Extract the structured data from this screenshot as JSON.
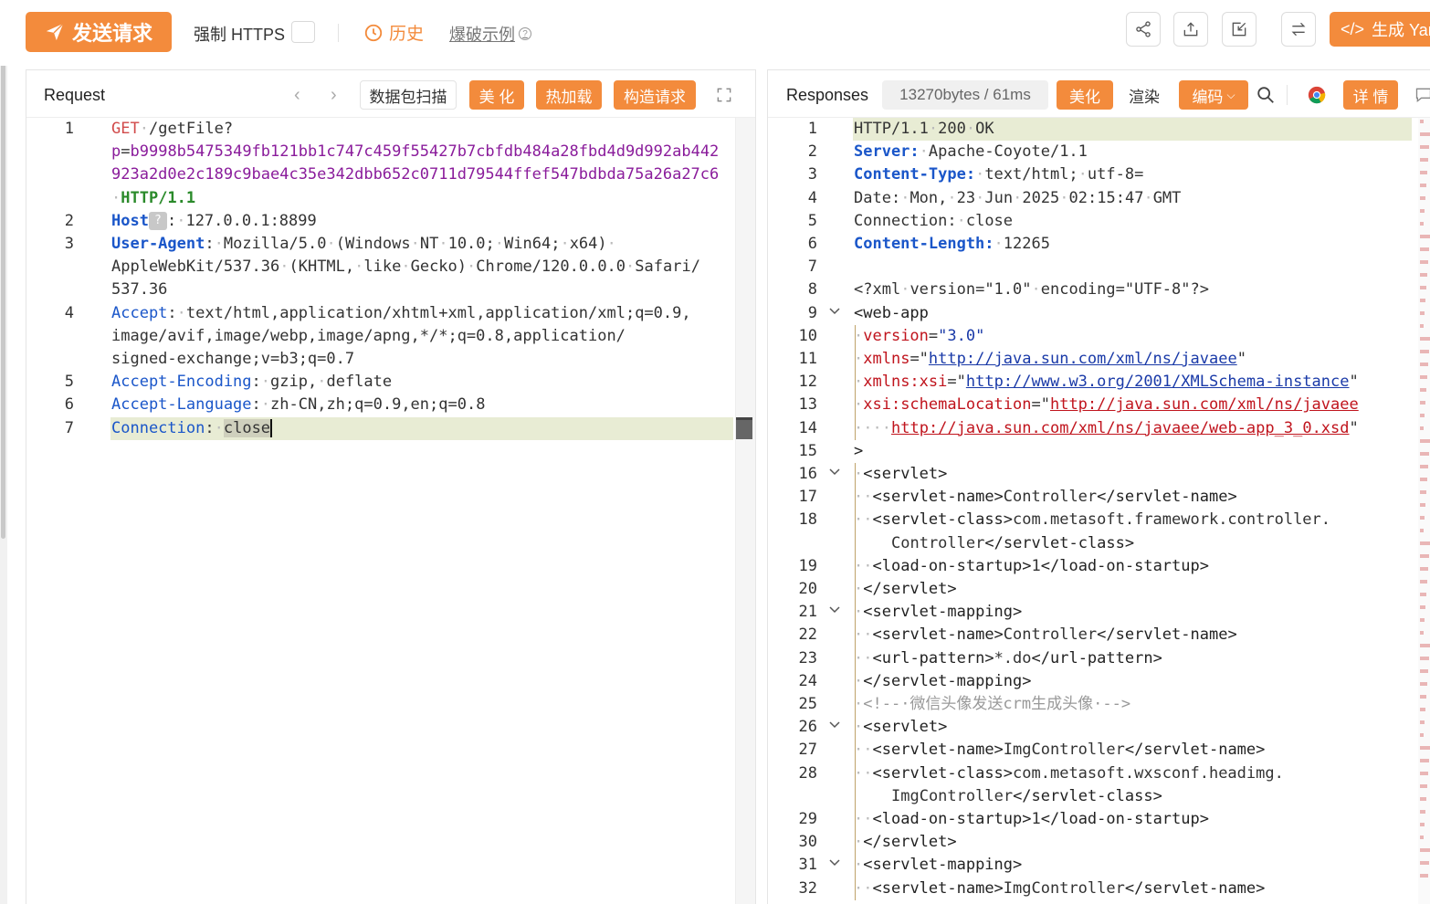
{
  "toolbar": {
    "send_label": "发送请求",
    "https_label": "强制 HTTPS",
    "history_label": "历史",
    "burst_label": "爆破示例",
    "generate_label": "生成 Yaml"
  },
  "request": {
    "title": "Request",
    "scan_label": "数据包扫描",
    "beautify_label": "美 化",
    "hotload_label": "热加载",
    "build_label": "构造请求",
    "line_numbers": [
      "1",
      "2",
      "3",
      "4",
      "5",
      "6",
      "7"
    ],
    "lines": [
      {
        "segments": [
          [
            "k-method",
            "GET"
          ],
          [
            "ws",
            "·"
          ],
          [
            "plain",
            "/getFile?"
          ]
        ]
      },
      {
        "segments": [
          [
            "k-param",
            "p"
          ],
          [
            "plain",
            "="
          ],
          [
            "k-param",
            "b9998b5475349fb121bb1c747c459f55427b7cbfdb484a28fbd4d9d992ab442"
          ]
        ]
      },
      {
        "segments": [
          [
            "k-param",
            "923a2d0e2c189c9bae4c35e342dbb652c0711d79544ffef547bdbda75a26a27c6"
          ]
        ]
      },
      {
        "segments": [
          [
            "ws",
            "·"
          ],
          [
            "k-ver",
            "HTTP/1.1"
          ]
        ]
      },
      {
        "segments": [
          [
            "k-hdr",
            "Host"
          ],
          [
            "badge",
            "?"
          ],
          [
            "plain",
            ":"
          ],
          [
            "ws",
            "·"
          ],
          [
            "plain",
            "127.0.0.1:8899"
          ]
        ]
      },
      {
        "segments": [
          [
            "k-hdr",
            "User-Agent"
          ],
          [
            "plain",
            ":"
          ],
          [
            "ws",
            "·"
          ],
          [
            "plain",
            "Mozilla/5.0"
          ],
          [
            "ws",
            "·"
          ],
          [
            "plain",
            "(Windows"
          ],
          [
            "ws",
            "·"
          ],
          [
            "plain",
            "NT"
          ],
          [
            "ws",
            "·"
          ],
          [
            "plain",
            "10.0;"
          ],
          [
            "ws",
            "·"
          ],
          [
            "plain",
            "Win64;"
          ],
          [
            "ws",
            "·"
          ],
          [
            "plain",
            "x64)"
          ],
          [
            "ws",
            "·"
          ]
        ]
      },
      {
        "segments": [
          [
            "plain",
            "AppleWebKit/537.36"
          ],
          [
            "ws",
            "·"
          ],
          [
            "plain",
            "(KHTML,"
          ],
          [
            "ws",
            "·"
          ],
          [
            "plain",
            "like"
          ],
          [
            "ws",
            "·"
          ],
          [
            "plain",
            "Gecko)"
          ],
          [
            "ws",
            "·"
          ],
          [
            "plain",
            "Chrome/120.0.0.0"
          ],
          [
            "ws",
            "·"
          ],
          [
            "plain",
            "Safari/"
          ]
        ]
      },
      {
        "segments": [
          [
            "plain",
            "537.36"
          ]
        ]
      },
      {
        "segments": [
          [
            "k-hdr2",
            "Accept"
          ],
          [
            "plain",
            ":"
          ],
          [
            "ws",
            "·"
          ],
          [
            "plain",
            "text/html,application/xhtml+xml,application/xml;q=0.9,"
          ]
        ]
      },
      {
        "segments": [
          [
            "plain",
            "image/avif,image/webp,image/apng,*/*;q=0.8,application/"
          ]
        ]
      },
      {
        "segments": [
          [
            "plain",
            "signed-exchange;v=b3;q=0.7"
          ]
        ]
      },
      {
        "segments": [
          [
            "k-hdr2",
            "Accept-Encoding"
          ],
          [
            "plain",
            ":"
          ],
          [
            "ws",
            "·"
          ],
          [
            "plain",
            "gzip,"
          ],
          [
            "ws",
            "·"
          ],
          [
            "plain",
            "deflate"
          ]
        ]
      },
      {
        "segments": [
          [
            "k-hdr2",
            "Accept-Language"
          ],
          [
            "plain",
            ":"
          ],
          [
            "ws",
            "·"
          ],
          [
            "plain",
            "zh-CN,zh;q=0.9,en;q=0.8"
          ]
        ]
      },
      {
        "segments": [
          [
            "k-hdr2",
            "Connection"
          ],
          [
            "plain",
            ":"
          ],
          [
            "ws",
            "·"
          ],
          [
            "sel",
            "close"
          ]
        ]
      }
    ]
  },
  "response": {
    "title": "Responses",
    "stats": "13270bytes / 61ms",
    "beautify_label": "美化",
    "render_label": "渲染",
    "encode_label": "编码",
    "detail_label": "详 情",
    "line_numbers": [
      "1",
      "2",
      "3",
      "4",
      "5",
      "6",
      "7",
      "8",
      "9",
      "10",
      "11",
      "12",
      "13",
      "14",
      "15",
      "16",
      "17",
      "18",
      "19",
      "20",
      "21",
      "22",
      "23",
      "24",
      "25",
      "26",
      "27",
      "28",
      "29",
      "30",
      "31",
      "32"
    ],
    "lines": [
      {
        "segments": [
          [
            "plain",
            "HTTP/1.1"
          ],
          [
            "ws",
            "·"
          ],
          [
            "plain",
            "200"
          ],
          [
            "ws",
            "·"
          ],
          [
            "plain",
            "OK"
          ]
        ]
      },
      {
        "segments": [
          [
            "k-hdr",
            "Server:"
          ],
          [
            "ws",
            "·"
          ],
          [
            "plain",
            "Apache-Coyote/1.1"
          ]
        ]
      },
      {
        "segments": [
          [
            "k-hdr",
            "Content-Type:"
          ],
          [
            "ws",
            "·"
          ],
          [
            "plain",
            "text/html;"
          ],
          [
            "ws",
            "·"
          ],
          [
            "plain",
            "utf-8="
          ]
        ]
      },
      {
        "segments": [
          [
            "plain",
            "Date:"
          ],
          [
            "ws",
            "·"
          ],
          [
            "plain",
            "Mon,"
          ],
          [
            "ws",
            "·"
          ],
          [
            "plain",
            "23"
          ],
          [
            "ws",
            "·"
          ],
          [
            "plain",
            "Jun"
          ],
          [
            "ws",
            "·"
          ],
          [
            "plain",
            "2025"
          ],
          [
            "ws",
            "·"
          ],
          [
            "plain",
            "02:15:47"
          ],
          [
            "ws",
            "·"
          ],
          [
            "plain",
            "GMT"
          ]
        ]
      },
      {
        "segments": [
          [
            "plain",
            "Connection:"
          ],
          [
            "ws",
            "·"
          ],
          [
            "plain",
            "close"
          ]
        ]
      },
      {
        "segments": [
          [
            "k-hdr",
            "Content-Length:"
          ],
          [
            "ws",
            "·"
          ],
          [
            "plain",
            "12265"
          ]
        ]
      },
      {
        "segments": []
      },
      {
        "segments": [
          [
            "plain",
            "<?xml"
          ],
          [
            "ws",
            "·"
          ],
          [
            "plain",
            "version=\"1.0\""
          ],
          [
            "ws",
            "·"
          ],
          [
            "plain",
            "encoding=\"UTF-8\"?>"
          ]
        ]
      },
      {
        "segments": [
          [
            "x-tag",
            "<web-app"
          ]
        ]
      },
      {
        "segments": [
          [
            "ws",
            "·"
          ],
          [
            "x-attr",
            "version"
          ],
          [
            "plain",
            "="
          ],
          [
            "x-val",
            "\"3.0\""
          ]
        ]
      },
      {
        "segments": [
          [
            "ws",
            "·"
          ],
          [
            "x-attr",
            "xmlns"
          ],
          [
            "plain",
            "=\""
          ],
          [
            "x-url",
            "http://java.sun.com/xml/ns/javaee"
          ],
          [
            "plain",
            "\""
          ]
        ]
      },
      {
        "segments": [
          [
            "ws",
            "·"
          ],
          [
            "x-attr",
            "xmlns:xsi"
          ],
          [
            "plain",
            "=\""
          ],
          [
            "x-url",
            "http://www.w3.org/2001/XMLSchema-instance"
          ],
          [
            "plain",
            "\""
          ]
        ]
      },
      {
        "segments": [
          [
            "ws",
            "·"
          ],
          [
            "x-attr",
            "xsi:schemaLocation"
          ],
          [
            "plain",
            "=\""
          ],
          [
            "x-url-red",
            "http://java.sun.com/xml/ns/javaee"
          ]
        ]
      },
      {
        "segments": [
          [
            "ws",
            "·"
          ],
          [
            "ws",
            "·"
          ],
          [
            "ws",
            "·"
          ],
          [
            "ws",
            "·"
          ],
          [
            "x-url-red",
            "http://java.sun.com/xml/ns/javaee/web-app_3_0.xsd"
          ],
          [
            "plain",
            "\""
          ]
        ]
      },
      {
        "segments": [
          [
            "x-tag",
            ">"
          ]
        ]
      },
      {
        "segments": [
          [
            "ws",
            "·"
          ],
          [
            "x-tag",
            "<servlet>"
          ]
        ]
      },
      {
        "segments": [
          [
            "ws",
            "·"
          ],
          [
            "ws",
            "·"
          ],
          [
            "x-tag",
            "<servlet-name>"
          ],
          [
            "plain",
            "Controller"
          ],
          [
            "x-tag",
            "</servlet-name>"
          ]
        ]
      },
      {
        "segments": [
          [
            "ws",
            "·"
          ],
          [
            "ws",
            "·"
          ],
          [
            "x-tag",
            "<servlet-class>"
          ],
          [
            "plain",
            "com.metasoft.framework.controller."
          ]
        ]
      },
      {
        "segments": [
          [
            "plain",
            "Controller"
          ],
          [
            "x-tag",
            "</servlet-class>"
          ]
        ]
      },
      {
        "segments": [
          [
            "ws",
            "·"
          ],
          [
            "ws",
            "·"
          ],
          [
            "x-tag",
            "<load-on-startup>"
          ],
          [
            "plain",
            "1"
          ],
          [
            "x-tag",
            "</load-on-startup>"
          ]
        ]
      },
      {
        "segments": [
          [
            "ws",
            "·"
          ],
          [
            "x-tag",
            "</servlet>"
          ]
        ]
      },
      {
        "segments": [
          [
            "ws",
            "·"
          ],
          [
            "x-tag",
            "<servlet-mapping>"
          ]
        ]
      },
      {
        "segments": [
          [
            "ws",
            "·"
          ],
          [
            "ws",
            "·"
          ],
          [
            "x-tag",
            "<servlet-name>"
          ],
          [
            "plain",
            "Controller"
          ],
          [
            "x-tag",
            "</servlet-name>"
          ]
        ]
      },
      {
        "segments": [
          [
            "ws",
            "·"
          ],
          [
            "ws",
            "·"
          ],
          [
            "x-tag",
            "<url-pattern>"
          ],
          [
            "plain",
            "*.do"
          ],
          [
            "x-tag",
            "</url-pattern>"
          ]
        ]
      },
      {
        "segments": [
          [
            "ws",
            "·"
          ],
          [
            "x-tag",
            "</servlet-mapping>"
          ]
        ]
      },
      {
        "segments": [
          [
            "ws",
            "·"
          ],
          [
            "x-cmt",
            "<!--·微信头像发送crm生成头像·-->"
          ]
        ]
      },
      {
        "segments": [
          [
            "ws",
            "·"
          ],
          [
            "x-tag",
            "<servlet>"
          ]
        ]
      },
      {
        "segments": [
          [
            "ws",
            "·"
          ],
          [
            "ws",
            "·"
          ],
          [
            "x-tag",
            "<servlet-name>"
          ],
          [
            "plain",
            "ImgController"
          ],
          [
            "x-tag",
            "</servlet-name>"
          ]
        ]
      },
      {
        "segments": [
          [
            "ws",
            "·"
          ],
          [
            "ws",
            "·"
          ],
          [
            "x-tag",
            "<servlet-class>"
          ],
          [
            "plain",
            "com.metasoft.wxsconf.headimg."
          ]
        ]
      },
      {
        "segments": [
          [
            "plain",
            "ImgController"
          ],
          [
            "x-tag",
            "</servlet-class>"
          ]
        ]
      },
      {
        "segments": [
          [
            "ws",
            "·"
          ],
          [
            "ws",
            "·"
          ],
          [
            "x-tag",
            "<load-on-startup>"
          ],
          [
            "plain",
            "1"
          ],
          [
            "x-tag",
            "</load-on-startup>"
          ]
        ]
      },
      {
        "segments": [
          [
            "ws",
            "·"
          ],
          [
            "x-tag",
            "</servlet>"
          ]
        ]
      },
      {
        "segments": [
          [
            "ws",
            "·"
          ],
          [
            "x-tag",
            "<servlet-mapping>"
          ]
        ]
      },
      {
        "segments": [
          [
            "ws",
            "·"
          ],
          [
            "ws",
            "·"
          ],
          [
            "x-tag",
            "<servlet-name>"
          ],
          [
            "plain",
            "ImgController"
          ],
          [
            "x-tag",
            "</servlet-name>"
          ]
        ]
      }
    ]
  }
}
